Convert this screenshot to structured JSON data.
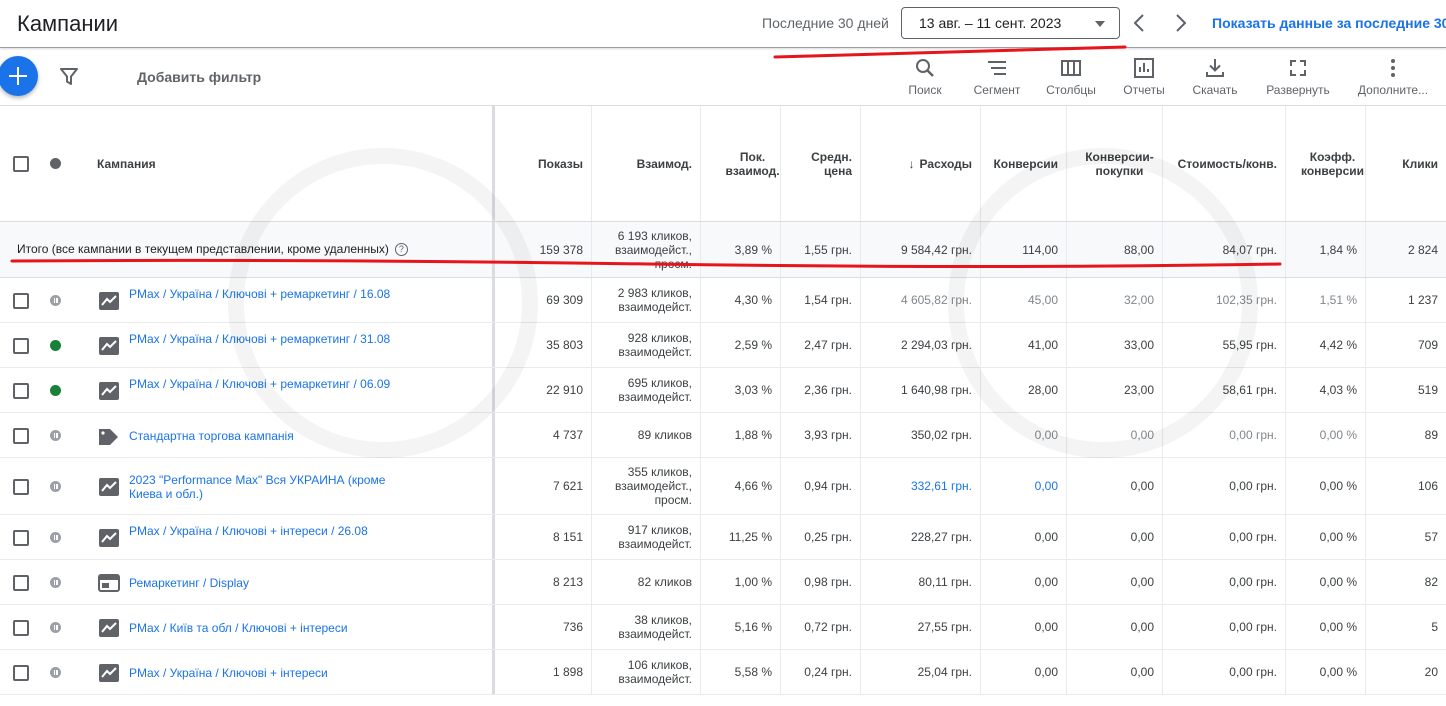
{
  "header": {
    "title": "Кампании",
    "period_label": "Последние 30 дней",
    "date_range": "13 авг. – 11 сент. 2023",
    "show_last_label": "Показать данные за последние 30"
  },
  "toolbar": {
    "add_filter": "Добавить фильтр",
    "tools": [
      {
        "label": "Поиск",
        "icon": "search-icon"
      },
      {
        "label": "Сегмент",
        "icon": "segment-icon"
      },
      {
        "label": "Столбцы",
        "icon": "columns-icon"
      },
      {
        "label": "Отчеты",
        "icon": "reports-icon"
      },
      {
        "label": "Скачать",
        "icon": "download-icon"
      },
      {
        "label": "Развернуть",
        "icon": "fullscreen-icon"
      },
      {
        "label": "Дополните...",
        "icon": "more-vert-icon"
      }
    ]
  },
  "columns": {
    "campaign": "Кампания",
    "impressions": "Показы",
    "interactions": "Взаимод.",
    "interaction_rate": "Пок. взаимод.",
    "avg_cost": "Средн. цена",
    "cost": "Расходы",
    "conversions": "Конверсии",
    "conv_purchases": "Конверсии-покупки",
    "cost_per_conv": "Стоимость/конв.",
    "conv_rate": "Коэфф. конверсии",
    "clicks": "Клики"
  },
  "total": {
    "label": "Итого (все кампании в текущем представлении, кроме удаленных)",
    "impressions": "159 378",
    "interactions": "6 193 кликов, взаимодейст., просм.",
    "interaction_rate": "3,89 %",
    "avg_cost": "1,55 грн.",
    "cost": "9 584,42 грн.",
    "conversions": "114,00",
    "conv_purchases": "88,00",
    "cost_per_conv": "84,07 грн.",
    "conv_rate": "1,84 %",
    "clicks": "2 824"
  },
  "rows": [
    {
      "status": "paused",
      "type": "pmax",
      "name": "PMax / Україна / Ключові + ремаркетинг / 16.08",
      "impressions": "69 309",
      "interactions": "2 983 кликов, взаимодейст.",
      "interaction_rate": "4,30 %",
      "avg_cost": "1,54 грн.",
      "cost": "4 605,82 грн.",
      "conversions": "45,00",
      "conv_purchases": "32,00",
      "cost_per_conv": "102,35 грн.",
      "conv_rate": "1,51 %",
      "clicks": "1 237"
    },
    {
      "status": "enabled",
      "type": "pmax",
      "name": "PMax / Україна / Ключові + ремаркетинг / 31.08",
      "impressions": "35 803",
      "interactions": "928 кликов, взаимодейст.",
      "interaction_rate": "2,59 %",
      "avg_cost": "2,47 грн.",
      "cost": "2 294,03 грн.",
      "conversions": "41,00",
      "conv_purchases": "33,00",
      "cost_per_conv": "55,95 грн.",
      "conv_rate": "4,42 %",
      "clicks": "709"
    },
    {
      "status": "enabled",
      "type": "pmax",
      "name": "PMax / Україна / Ключові + ремаркетинг / 06.09",
      "impressions": "22 910",
      "interactions": "695 кликов, взаимодейст.",
      "interaction_rate": "3,03 %",
      "avg_cost": "2,36 грн.",
      "cost": "1 640,98 грн.",
      "conversions": "28,00",
      "conv_purchases": "23,00",
      "cost_per_conv": "58,61 грн.",
      "conv_rate": "4,03 %",
      "clicks": "519"
    },
    {
      "status": "paused",
      "type": "shopping",
      "name": "Стандартна торгова кампанія",
      "impressions": "4 737",
      "interactions": "89 кликов",
      "interaction_rate": "1,88 %",
      "avg_cost": "3,93 грн.",
      "cost": "350,02 грн.",
      "conversions": "0,00",
      "conv_purchases": "0,00",
      "cost_per_conv": "0,00 грн.",
      "conv_rate": "0,00 %",
      "clicks": "89"
    },
    {
      "status": "paused",
      "type": "pmax",
      "name": "2023 \"Performance Max\"  Вся УКРАИНА (кроме Киева и обл.)",
      "impressions": "7 621",
      "interactions": "355 кликов, взаимодейст., просм.",
      "interaction_rate": "4,66 %",
      "avg_cost": "0,94 грн.",
      "cost": "332,61 грн.",
      "conversions": "0,00",
      "conv_purchases": "0,00",
      "cost_per_conv": "0,00 грн.",
      "conv_rate": "0,00 %",
      "clicks": "106"
    },
    {
      "status": "paused",
      "type": "pmax",
      "name": "PMax / Україна / Ключові + інтереси / 26.08",
      "impressions": "8 151",
      "interactions": "917 кликов, взаимодейст.",
      "interaction_rate": "11,25 %",
      "avg_cost": "0,25 грн.",
      "cost": "228,27 грн.",
      "conversions": "0,00",
      "conv_purchases": "0,00",
      "cost_per_conv": "0,00 грн.",
      "conv_rate": "0,00 %",
      "clicks": "57"
    },
    {
      "status": "paused",
      "type": "display",
      "name": "Ремаркетинг / Display",
      "impressions": "8 213",
      "interactions": "82 кликов",
      "interaction_rate": "1,00 %",
      "avg_cost": "0,98 грн.",
      "cost": "80,11 грн.",
      "conversions": "0,00",
      "conv_purchases": "0,00",
      "cost_per_conv": "0,00 грн.",
      "conv_rate": "0,00 %",
      "clicks": "82"
    },
    {
      "status": "paused",
      "type": "pmax",
      "name": "PMax / Київ та обл / Ключові + інтереси",
      "impressions": "736",
      "interactions": "38 кликов, взаимодейст.",
      "interaction_rate": "5,16 %",
      "avg_cost": "0,72 грн.",
      "cost": "27,55 грн.",
      "conversions": "0,00",
      "conv_purchases": "0,00",
      "cost_per_conv": "0,00 грн.",
      "conv_rate": "0,00 %",
      "clicks": "5"
    },
    {
      "status": "paused",
      "type": "pmax",
      "name": "PMax / Україна / Ключові + інтереси",
      "impressions": "1 898",
      "interactions": "106 кликов, взаимодейст.",
      "interaction_rate": "5,58 %",
      "avg_cost": "0,24 грн.",
      "cost": "25,04 грн.",
      "conversions": "0,00",
      "conv_purchases": "0,00",
      "cost_per_conv": "0,00 грн.",
      "conv_rate": "0,00 %",
      "clicks": "20"
    }
  ],
  "colors": {
    "accent": "#1a73e8",
    "enabled": "#188038",
    "paused": "#9aa0a6",
    "annotation": "#e8141b"
  }
}
